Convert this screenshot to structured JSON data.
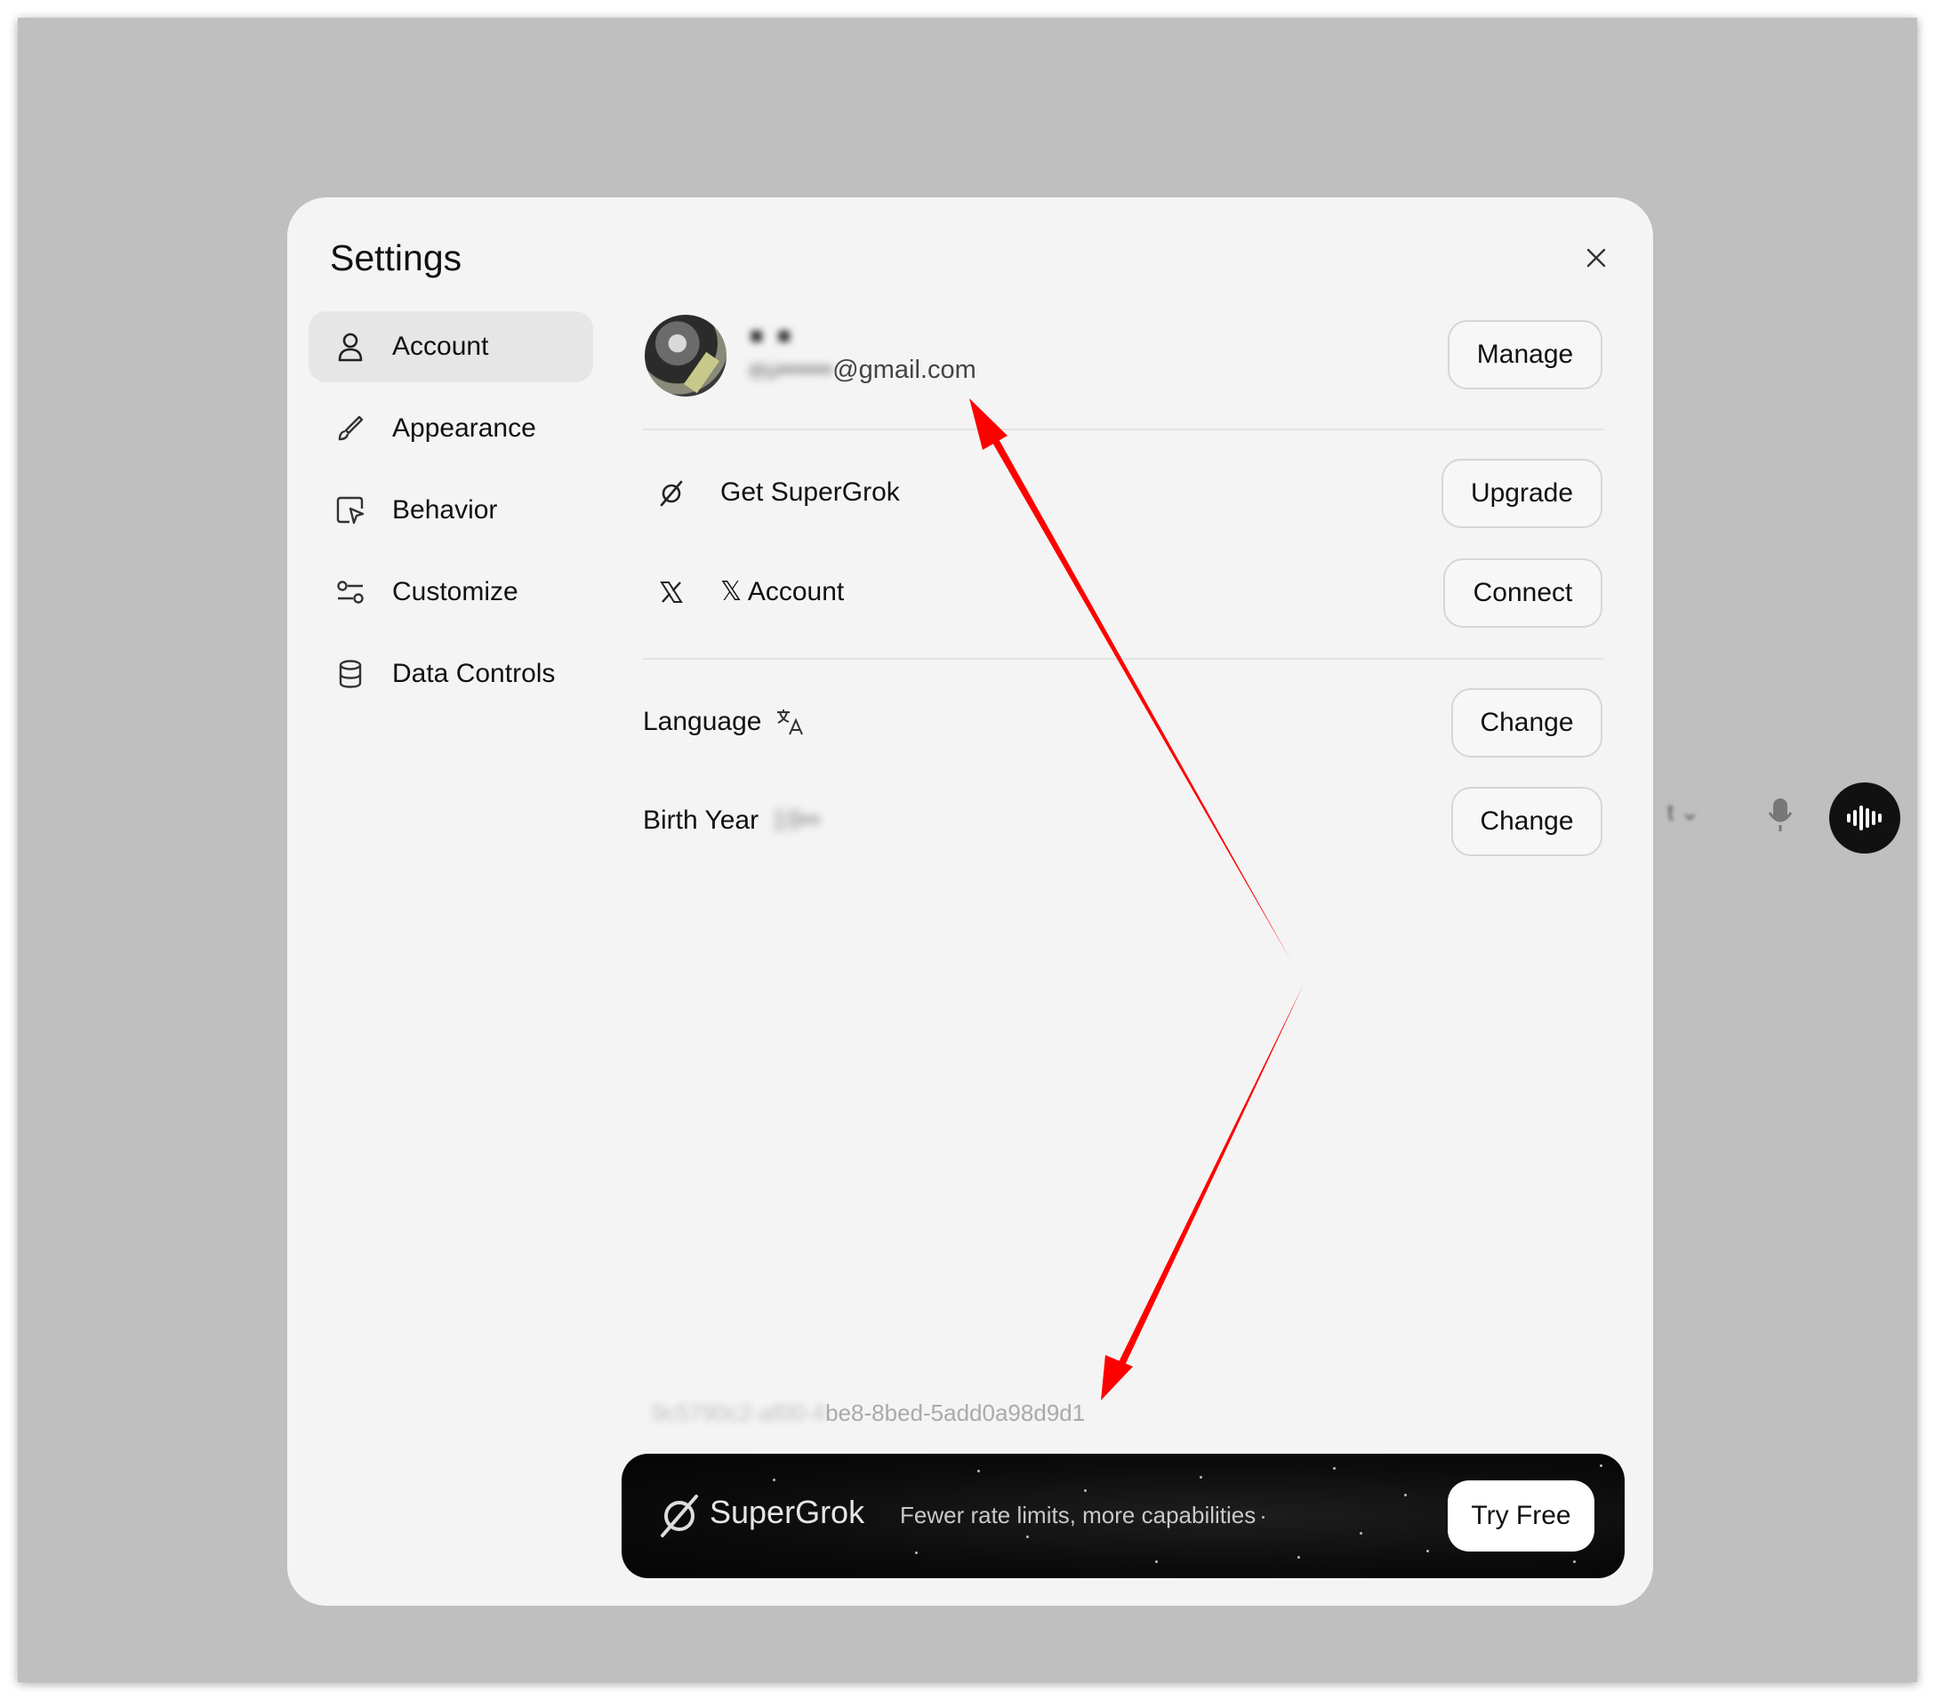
{
  "modal": {
    "title": "Settings"
  },
  "nav": {
    "items": [
      {
        "label": "Account",
        "icon": "user-icon",
        "active": true
      },
      {
        "label": "Appearance",
        "icon": "brush-icon",
        "active": false
      },
      {
        "label": "Behavior",
        "icon": "cursor-box-icon",
        "active": false
      },
      {
        "label": "Customize",
        "icon": "sliders-icon",
        "active": false
      },
      {
        "label": "Data Controls",
        "icon": "database-icon",
        "active": false
      }
    ]
  },
  "profile": {
    "name": "■ ■",
    "email_hidden": "eu••••••",
    "email_domain": "@gmail.com",
    "manage_label": "Manage"
  },
  "subscription": {
    "label": "Get SuperGrok",
    "icon": "grok-logo-icon",
    "button": "Upgrade"
  },
  "x_account": {
    "label": "𝕏 Account",
    "icon": "x-logo-icon",
    "button": "Connect"
  },
  "language": {
    "label": "Language",
    "icon": "translate-icon",
    "button": "Change"
  },
  "birth_year": {
    "label": "Birth Year",
    "value": "19••",
    "button": "Change"
  },
  "user_id": {
    "hidden": "9c5790c2-af00-4",
    "visible": "be8-8bed-5add0a98d9d1"
  },
  "banner": {
    "brand": "SuperGrok",
    "tagline": "Fewer rate limits, more capabilities",
    "button": "Try Free"
  },
  "colors": {
    "modal_bg": "#f4f4f4",
    "backdrop": "#bfbfbf",
    "annotation_arrow": "#ff0000",
    "banner_bg": "#0b0b0b"
  }
}
